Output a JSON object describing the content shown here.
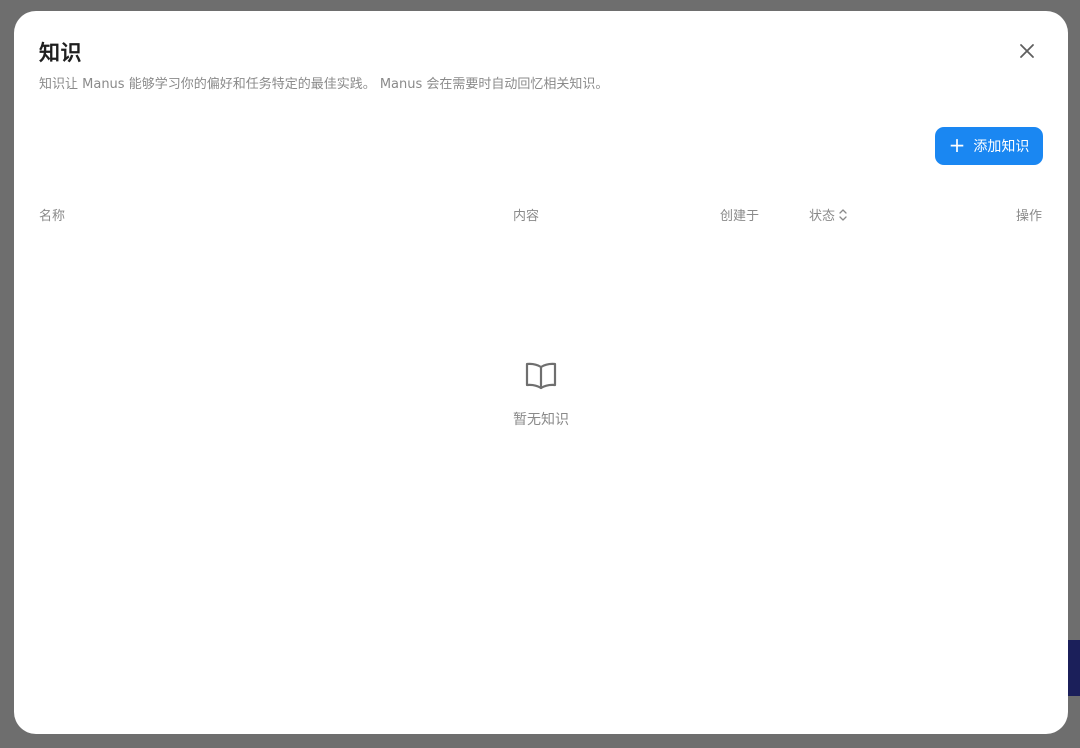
{
  "dialog": {
    "title": "知识",
    "subtitle": "知识让 Manus 能够学习你的偏好和任务特定的最佳实践。 Manus 会在需要时自动回忆相关知识。",
    "close_icon": "close-icon"
  },
  "toolbar": {
    "add_label": "添加知识",
    "add_icon": "plus-icon",
    "accent_color": "#1a87f2"
  },
  "table": {
    "columns": {
      "name": "名称",
      "content": "内容",
      "created": "创建于",
      "status": "状态",
      "actions": "操作"
    },
    "status_sort_icon": "sort-icon"
  },
  "empty_state": {
    "icon": "book-icon",
    "text": "暂无知识"
  }
}
